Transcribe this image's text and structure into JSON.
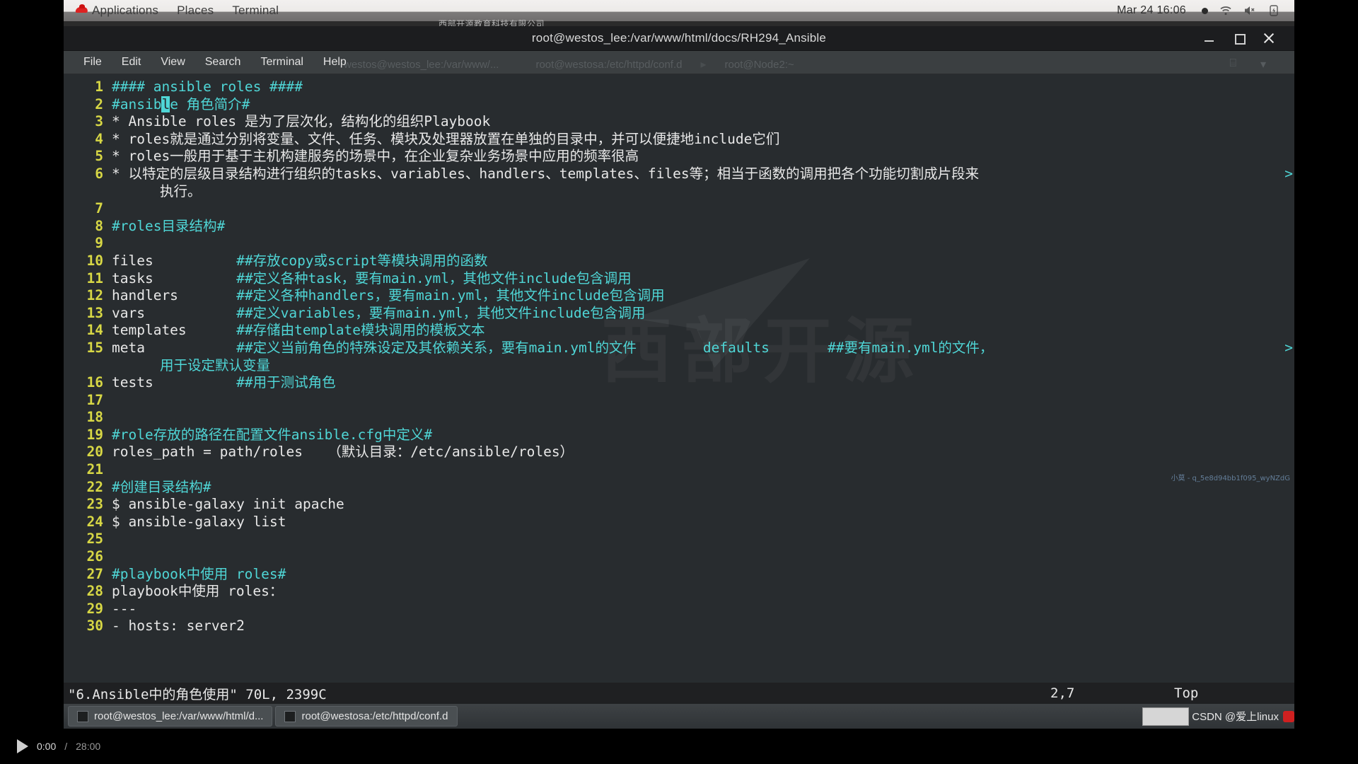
{
  "desktop": {
    "top_panel": {
      "applications_label": "Applications",
      "places_label": "Places",
      "terminal_label": "Terminal",
      "clock": "Mar 24  16:06",
      "icons": [
        "redhat-icon",
        "record-dot-icon",
        "wifi-icon",
        "volume-muted-icon",
        "battery-charging-icon"
      ]
    },
    "watermark_top": "西部开源教育科技有限公司",
    "watermark_big": "西部开源",
    "tiny_credit": "小莫 - q_5e8d94bb1f095_wyNZdG"
  },
  "window": {
    "title": "root@westos_lee:/var/www/html/docs/RH294_Ansible",
    "buttons": {
      "minimize": "minimize-button",
      "maximize": "maximize-button",
      "close": "close-button"
    },
    "menu": [
      "File",
      "Edit",
      "View",
      "Search",
      "Terminal",
      "Help"
    ]
  },
  "ghost_tabs": [
    "westos@westos_lee:/var/www/...",
    "root@westosa:/etc/httpd/conf.d",
    "root@Node2:~"
  ],
  "editor": {
    "lines": [
      {
        "n": "1",
        "segments": [
          {
            "t": "#### ansible roles ####",
            "c": "cyan"
          }
        ]
      },
      {
        "n": "2",
        "segments": [
          {
            "t": "#ansib",
            "c": "cyan"
          },
          {
            "t": "l",
            "c": "cursor"
          },
          {
            "t": "e 角色简介#",
            "c": "cyan"
          }
        ]
      },
      {
        "n": "3",
        "segments": [
          {
            "t": "* Ansible roles 是为了层次化，结构化的组织Playbook",
            "c": "white"
          }
        ]
      },
      {
        "n": "4",
        "segments": [
          {
            "t": "* roles就是通过分别将变量、文件、任务、模块及处理器放置在单独的目录中，并可以便捷地include它们",
            "c": "white"
          }
        ]
      },
      {
        "n": "5",
        "segments": [
          {
            "t": "* roles一般用于基于主机构建服务的场景中，在企业复杂业务场景中应用的频率很高",
            "c": "white"
          }
        ]
      },
      {
        "n": "6",
        "segments": [
          {
            "t": "* 以特定的层级目录结构进行组织的tasks、variables、handlers、templates、files等；相当于函数的调用把各个功能切割成片段来",
            "c": "white"
          }
        ],
        "wrap_mark": ">"
      },
      {
        "n": "",
        "wrap": true,
        "segments": [
          {
            "t": "执行。",
            "c": "white"
          }
        ]
      },
      {
        "n": "7",
        "segments": []
      },
      {
        "n": "8",
        "segments": [
          {
            "t": "#roles目录结构#",
            "c": "cyan"
          }
        ]
      },
      {
        "n": "9",
        "segments": []
      },
      {
        "n": "10",
        "segments": [
          {
            "t": "files          ",
            "c": "white"
          },
          {
            "t": "##存放copy或script等模块调用的函数",
            "c": "cyan"
          }
        ]
      },
      {
        "n": "11",
        "segments": [
          {
            "t": "tasks          ",
            "c": "white"
          },
          {
            "t": "##定义各种task，要有main.yml，其他文件include包含调用",
            "c": "cyan"
          }
        ]
      },
      {
        "n": "12",
        "segments": [
          {
            "t": "handlers       ",
            "c": "white"
          },
          {
            "t": "##定义各种handlers，要有main.yml，其他文件include包含调用",
            "c": "cyan"
          }
        ]
      },
      {
        "n": "13",
        "segments": [
          {
            "t": "vars           ",
            "c": "white"
          },
          {
            "t": "##定义variables，要有main.yml，其他文件include包含调用",
            "c": "cyan"
          }
        ]
      },
      {
        "n": "14",
        "segments": [
          {
            "t": "templates      ",
            "c": "white"
          },
          {
            "t": "##存储由template模块调用的模板文本",
            "c": "cyan"
          }
        ]
      },
      {
        "n": "15",
        "segments": [
          {
            "t": "meta           ",
            "c": "white"
          },
          {
            "t": "##定义当前角色的特殊设定及其依赖关系，要有main.yml的文件        defaults       ##要有main.yml的文件，",
            "c": "cyan"
          }
        ],
        "wrap_mark": ">"
      },
      {
        "n": "",
        "wrap": true,
        "segments": [
          {
            "t": "用于设定默认变量",
            "c": "cyan"
          }
        ]
      },
      {
        "n": "16",
        "segments": [
          {
            "t": "tests          ",
            "c": "white"
          },
          {
            "t": "##用于测试角色",
            "c": "cyan"
          }
        ]
      },
      {
        "n": "17",
        "segments": []
      },
      {
        "n": "18",
        "segments": []
      },
      {
        "n": "19",
        "segments": [
          {
            "t": "#role存放的路径在配置文件ansible.cfg中定义#",
            "c": "cyan"
          }
        ]
      },
      {
        "n": "20",
        "segments": [
          {
            "t": "roles_path = path/roles   （默认目录：/etc/ansible/roles）",
            "c": "white"
          }
        ]
      },
      {
        "n": "21",
        "segments": []
      },
      {
        "n": "22",
        "segments": [
          {
            "t": "#创建目录结构#",
            "c": "cyan"
          }
        ]
      },
      {
        "n": "23",
        "segments": [
          {
            "t": "$ ansible-galaxy init apache",
            "c": "white"
          }
        ]
      },
      {
        "n": "24",
        "segments": [
          {
            "t": "$ ansible-galaxy list",
            "c": "white"
          }
        ]
      },
      {
        "n": "25",
        "segments": []
      },
      {
        "n": "26",
        "segments": []
      },
      {
        "n": "27",
        "segments": [
          {
            "t": "#playbook中使用 roles#",
            "c": "cyan"
          }
        ]
      },
      {
        "n": "28",
        "segments": [
          {
            "t": "playbook中使用 roles：",
            "c": "white"
          }
        ]
      },
      {
        "n": "29",
        "segments": [
          {
            "t": "---",
            "c": "white"
          }
        ]
      },
      {
        "n": "30",
        "segments": [
          {
            "t": "- hosts: server2",
            "c": "white"
          }
        ]
      }
    ]
  },
  "statusline": {
    "file_info": "\"6.Ansible中的角色使用\" 70L, 2399C",
    "position": "2,7",
    "scroll": "Top"
  },
  "taskbar": {
    "tasks": [
      "root@westos_lee:/var/www/html/d...",
      "root@westosa:/etc/httpd/conf.d"
    ],
    "csdn_label": "CSDN @爱上linux"
  },
  "player": {
    "current_time": "0:00",
    "separator": "/",
    "total_time": "28:00"
  }
}
